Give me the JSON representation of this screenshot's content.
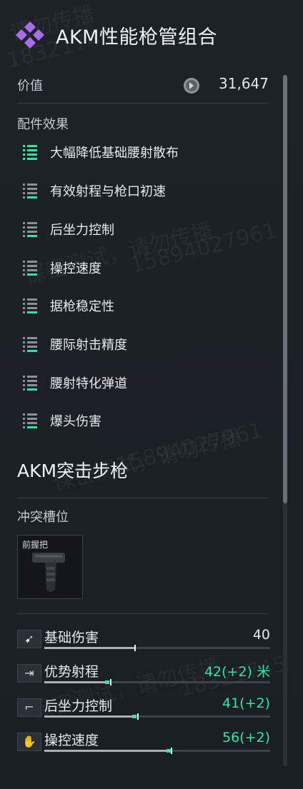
{
  "header": {
    "title": "AKM性能枪管组合",
    "icon": "purple-diamond-cluster-icon"
  },
  "value": {
    "label": "价值",
    "amount": "31,647",
    "icon": "coin-icon"
  },
  "effects": {
    "label": "配件效果",
    "items": [
      {
        "text": "大幅降低基础腰射散布",
        "level": 3
      },
      {
        "text": "有效射程与枪口初速",
        "level": 1
      },
      {
        "text": "后坐力控制",
        "level": 1
      },
      {
        "text": "操控速度",
        "level": 1
      },
      {
        "text": "据枪稳定性",
        "level": 1
      },
      {
        "text": "腰际射击精度",
        "level": 1
      },
      {
        "text": "腰射特化弹道",
        "level": 1
      },
      {
        "text": "爆头伤害",
        "level": 1
      }
    ]
  },
  "weapon": {
    "title": "AKM突击步枪",
    "conflict_label": "冲突槽位",
    "slot": {
      "label": "前握把",
      "icon": "foregrip-icon"
    }
  },
  "stats": [
    {
      "name": "基础伤害",
      "value": "40",
      "icon": "damage-icon",
      "fill": 0.4,
      "delta": 0,
      "highlight": false
    },
    {
      "name": "优势射程",
      "value": "42(+2) 米",
      "icon": "range-arrow-icon",
      "fill": 0.27,
      "delta": 0.02,
      "highlight": true
    },
    {
      "name": "后坐力控制",
      "value": "41(+2)",
      "icon": "pistol-icon",
      "fill": 0.39,
      "delta": 0.02,
      "highlight": true
    },
    {
      "name": "操控速度",
      "value": "56(+2)",
      "icon": "hand-icon",
      "fill": 0.54,
      "delta": 0.02,
      "highlight": true
    }
  ],
  "watermarks": [
    "请勿传播",
    "18321745",
    "保密测试，请勿传播",
    "15894027961"
  ],
  "colors": {
    "accent_green": "#2be7a6",
    "title_purple": "#a96cf0",
    "background": "#1c2126"
  }
}
